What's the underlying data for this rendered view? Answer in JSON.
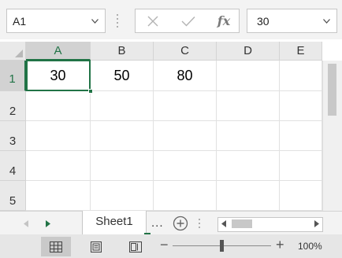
{
  "formula_bar": {
    "name_box": "A1",
    "cancel_icon": "x-icon",
    "enter_icon": "checkmark-icon",
    "function_label": "fx",
    "value": "30"
  },
  "columns": [
    "A",
    "B",
    "C",
    "D",
    "E"
  ],
  "rows": [
    "1",
    "2",
    "3",
    "4",
    "5"
  ],
  "cells": {
    "A1": "30",
    "B1": "50",
    "C1": "80"
  },
  "selection": {
    "active_cell": "A1",
    "selected_column": "A",
    "selected_row": "1"
  },
  "sheet_tabs": [
    {
      "name": "Sheet1",
      "active": true
    }
  ],
  "tab_bar": {
    "more_label": "...",
    "add_sheet_icon": "plus-circle-icon"
  },
  "status_bar": {
    "views": [
      "normal-view-icon",
      "page-layout-icon",
      "page-break-preview-icon"
    ],
    "zoom_minus": "−",
    "zoom_plus": "+",
    "zoom_level": "100%"
  },
  "colors": {
    "accent": "#217346",
    "header_bg": "#e9e9e9",
    "selected_header_bg": "#d2d2d2"
  }
}
